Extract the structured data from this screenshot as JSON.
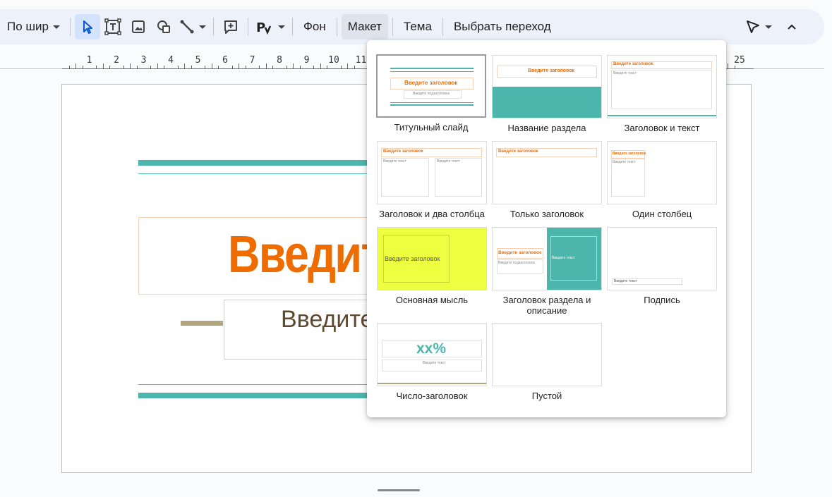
{
  "toolbar": {
    "zoom_label": "По шир",
    "background_label": "Фон",
    "layout_label": "Макет",
    "theme_label": "Тема",
    "transition_label": "Выбрать переход"
  },
  "ruler": {
    "numbers": [
      "1",
      "2",
      "3",
      "4",
      "5",
      "6",
      "7",
      "8",
      "9",
      "10",
      "11",
      "25"
    ]
  },
  "slide": {
    "title_placeholder": "Введите",
    "subtitle_placeholder": "Введите"
  },
  "layout_menu": {
    "items": [
      {
        "label": "Титульный слайд",
        "selected": true
      },
      {
        "label": "Название раздела"
      },
      {
        "label": "Заголовок и текст"
      },
      {
        "label": "Заголовок и два столбца"
      },
      {
        "label": "Только заголовок"
      },
      {
        "label": "Один столбец"
      },
      {
        "label": "Основная мысль"
      },
      {
        "label": "Заголовок раздела и описание"
      },
      {
        "label": "Подпись"
      },
      {
        "label": "Число-заголовок"
      },
      {
        "label": "Пустой"
      }
    ],
    "thumb_texts": {
      "title": "Введите заголовок",
      "subtitle": "Введите подзаголовок",
      "text": "Введите текст",
      "number": "xx%"
    }
  },
  "colors": {
    "accent_teal": "#4db6ac",
    "accent_orange": "#ef6c00",
    "accent_yellow": "#eeff41",
    "toolbar_bg": "#edf2fa",
    "active_tool": "#d3e3fd"
  }
}
